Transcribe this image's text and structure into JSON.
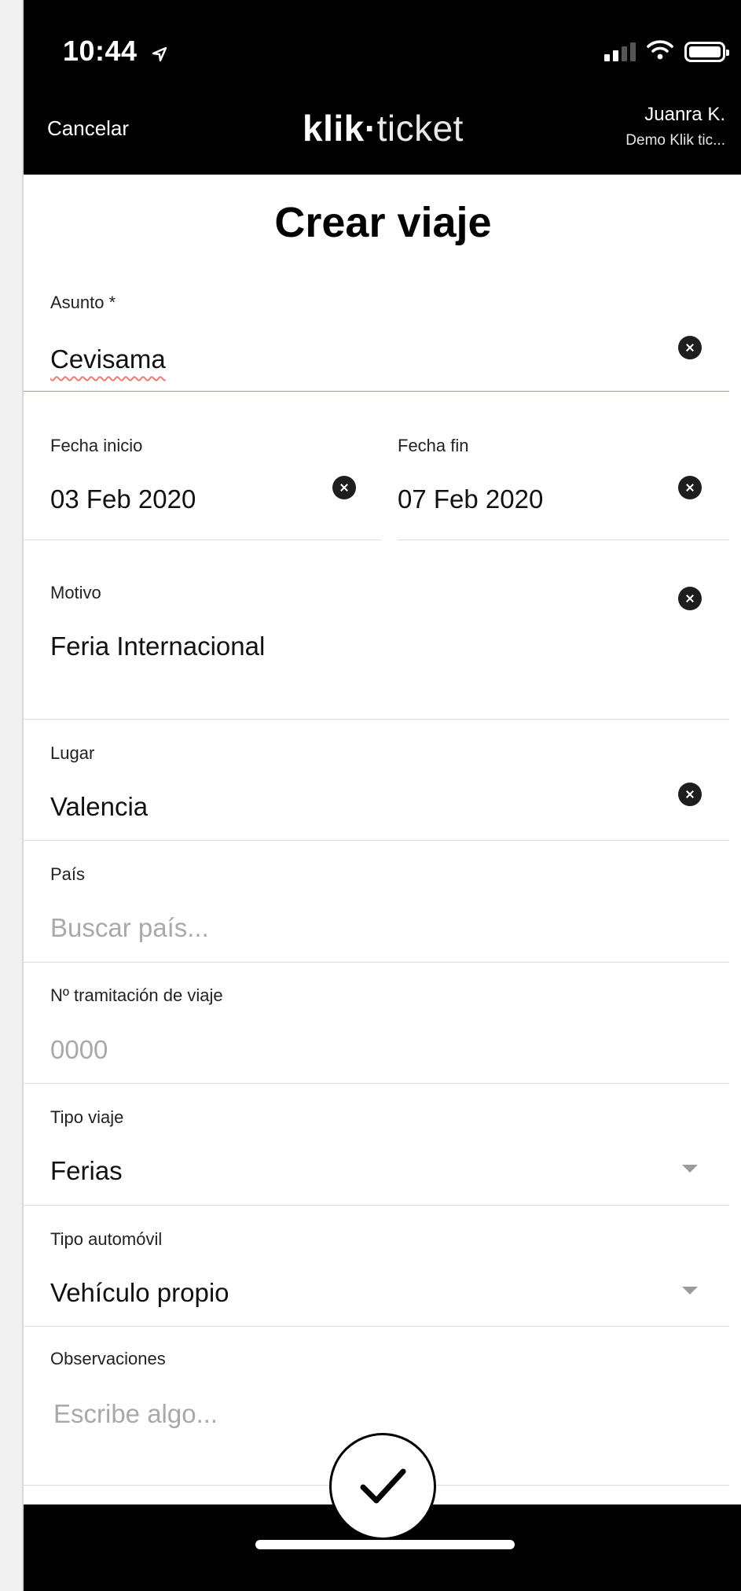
{
  "status_bar": {
    "time": "10:44"
  },
  "header": {
    "cancel_label": "Cancelar",
    "logo_bold": "klik",
    "logo_dot": "·",
    "logo_light": "ticket",
    "user_name": "Juanra K.",
    "user_company": "Demo Klik tic..."
  },
  "page": {
    "title": "Crear viaje"
  },
  "form": {
    "asunto": {
      "label": "Asunto *",
      "value": "Cevisama"
    },
    "fecha_inicio": {
      "label": "Fecha inicio",
      "value": "03 Feb 2020"
    },
    "fecha_fin": {
      "label": "Fecha fin",
      "value": "07 Feb 2020"
    },
    "motivo": {
      "label": "Motivo",
      "value": "Feria Internacional"
    },
    "lugar": {
      "label": "Lugar",
      "value": "Valencia"
    },
    "pais": {
      "label": "País",
      "placeholder": "Buscar país..."
    },
    "tramitacion": {
      "label": "Nº tramitación de viaje",
      "placeholder": "0000"
    },
    "tipo_viaje": {
      "label": "Tipo viaje",
      "value": "Ferias"
    },
    "tipo_automovil": {
      "label": "Tipo automóvil",
      "value": "Vehículo propio"
    },
    "observaciones": {
      "label": "Observaciones",
      "placeholder": "Escribe algo..."
    }
  },
  "colors": {
    "header_bg": "#000000",
    "active_underline": "#f07a6d",
    "placeholder": "#a9a9a9"
  },
  "icons": [
    "location-arrow-icon",
    "signal-icon",
    "wifi-icon",
    "battery-icon",
    "clear-icon",
    "dropdown-caret-icon",
    "checkmark-icon"
  ]
}
